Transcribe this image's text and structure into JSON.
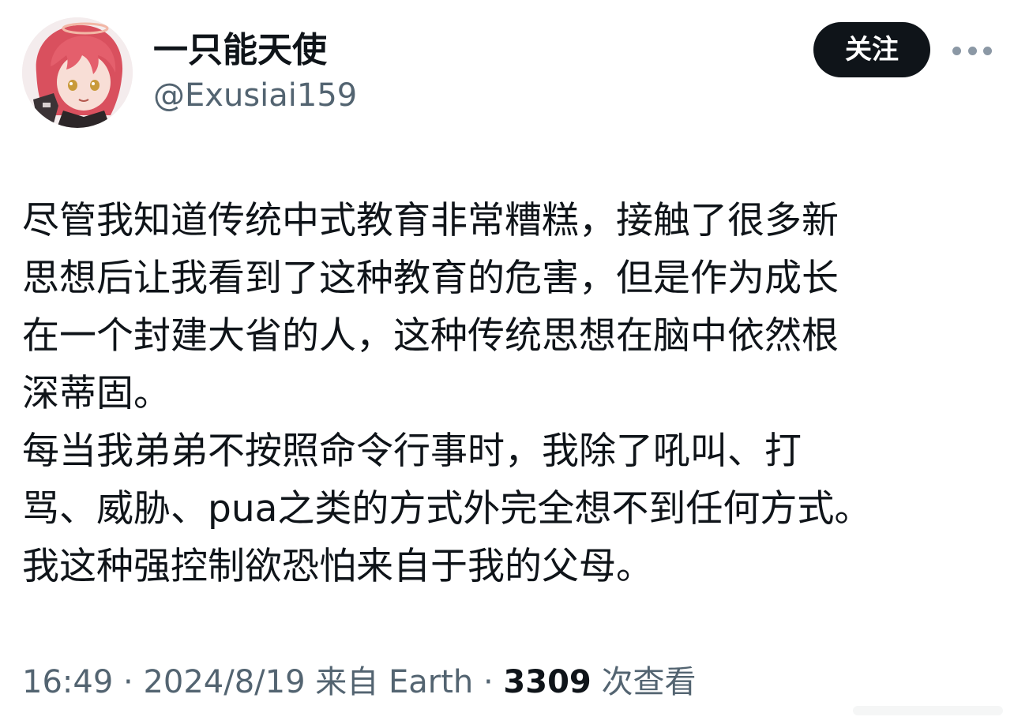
{
  "author": {
    "display_name": "一只能天使",
    "handle": "@Exusiai159",
    "avatar_icon": "anime-avatar-icon"
  },
  "actions": {
    "follow_label": "关注",
    "more_icon": "more-horizontal-icon"
  },
  "tweet": {
    "lines": [
      "尽管我知道传统中式教育非常糟糕，接触了很多新",
      "思想后让我看到了这种教育的危害，但是作为成长",
      "在一个封建大省的人，这种传统思想在脑中依然根",
      "深蒂固。",
      "每当我弟弟不按照命令行事时，我除了吼叫、打",
      "骂、威胁、pua之类的方式外完全想不到任何方式。",
      "我这种强控制欲恐怕来自于我的父母。"
    ]
  },
  "meta": {
    "time": "16:49",
    "separator": "·",
    "date": "2024/8/19",
    "source": "来自 Earth",
    "views_count": "3309",
    "views_label": "次查看"
  },
  "colors": {
    "text_primary": "#0f1419",
    "text_secondary": "#536471",
    "button_bg": "#0f1419",
    "avatar_hair": "#e05a66"
  }
}
